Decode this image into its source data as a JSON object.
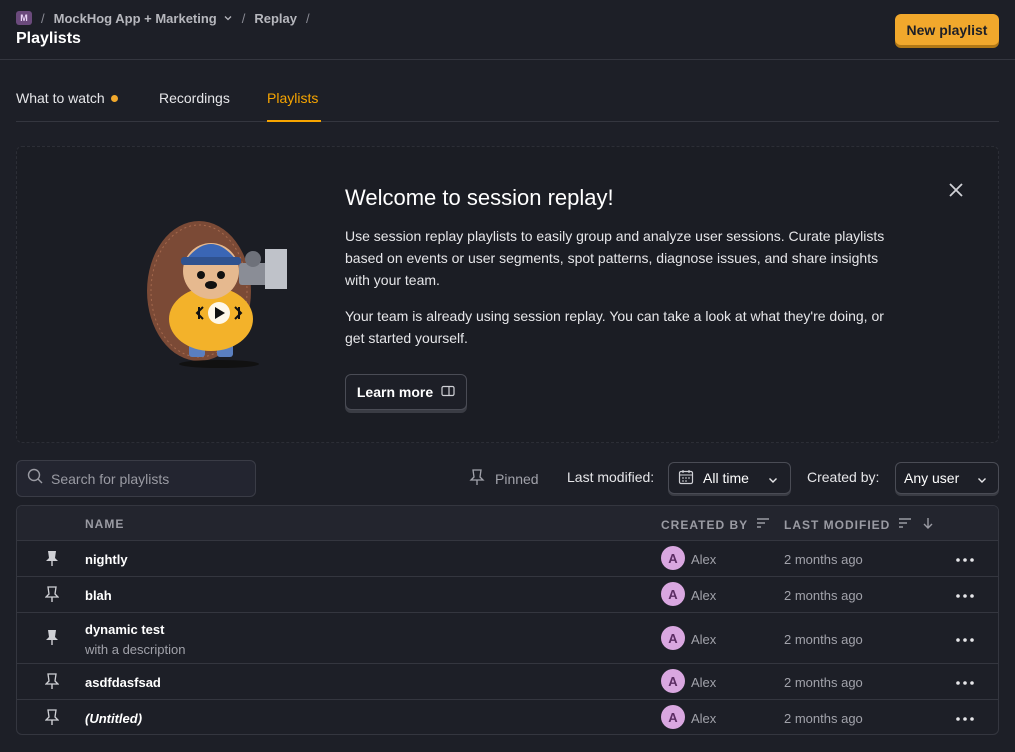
{
  "breadcrumb": {
    "org_badge": "M",
    "project": "MockHog App + Marketing",
    "section": "Replay"
  },
  "page_title": "Playlists",
  "header": {
    "new_playlist_label": "New playlist"
  },
  "tabs": [
    {
      "label": "What to watch",
      "has_dot": true
    },
    {
      "label": "Recordings"
    },
    {
      "label": "Playlists",
      "active": true
    }
  ],
  "welcome": {
    "title": "Welcome to session replay!",
    "paragraph1": "Use session replay playlists to easily group and analyze user sessions. Curate playlists based on events or user segments, spot patterns, diagnose issues, and share insights with your team.",
    "paragraph2": "Your team is already using session replay. You can take a look at what they're doing, or get started yourself.",
    "learn_more_label": "Learn more"
  },
  "filters": {
    "search_placeholder": "Search for playlists",
    "pinned_label": "Pinned",
    "last_modified_label": "Last modified:",
    "last_modified_value": "All time",
    "created_by_label": "Created by:",
    "created_by_value": "Any user"
  },
  "table": {
    "columns": {
      "name": "NAME",
      "created_by": "CREATED BY",
      "last_modified": "LAST MODIFIED"
    },
    "rows": [
      {
        "name": "nightly",
        "description": "",
        "pinned": true,
        "avatar": "A",
        "creator": "Alex",
        "modified": "2 months ago"
      },
      {
        "name": "blah",
        "description": "",
        "pinned": false,
        "avatar": "A",
        "creator": "Alex",
        "modified": "2 months ago"
      },
      {
        "name": "dynamic test",
        "description": "with a description",
        "pinned": true,
        "avatar": "A",
        "creator": "Alex",
        "modified": "2 months ago"
      },
      {
        "name": "asdfdasfsad",
        "description": "",
        "pinned": false,
        "avatar": "A",
        "creator": "Alex",
        "modified": "2 months ago"
      },
      {
        "name": "(Untitled)",
        "description": "",
        "pinned": false,
        "avatar": "A",
        "creator": "Alex",
        "modified": "2 months ago"
      }
    ]
  },
  "colors": {
    "accent": "#f7a501",
    "background": "#1d1f27",
    "avatar_bg": "#d9a7e0"
  }
}
